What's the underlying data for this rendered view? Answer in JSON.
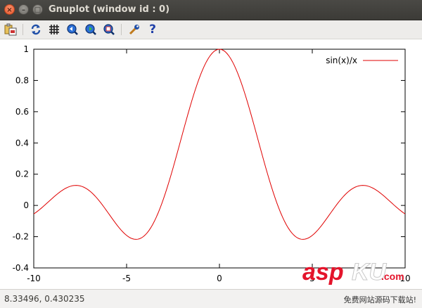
{
  "window": {
    "title": "Gnuplot (window id : 0)",
    "buttons": [
      "close",
      "minimize",
      "maximize"
    ]
  },
  "toolbar": {
    "icons": [
      "copy-to-clipboard-icon",
      "replot-icon",
      "grid-icon",
      "zoom-previous-icon",
      "zoom-next-icon",
      "zoom-autoscale-icon",
      "configuration-icon",
      "help-icon"
    ],
    "help_glyph": "?"
  },
  "chart_data": {
    "type": "line",
    "function": "sin(x)/x",
    "xlim": [
      -10,
      10
    ],
    "ylim": [
      -0.4,
      1
    ],
    "xticks": [
      -10,
      -5,
      0,
      5,
      10
    ],
    "yticks": [
      -0.4,
      -0.2,
      0,
      0.2,
      0.4,
      0.6,
      0.8,
      1
    ],
    "xtick_labels": [
      "-10",
      "-5",
      "0",
      "5",
      "10"
    ],
    "ytick_labels": [
      "-0.4",
      "-0.2",
      "0",
      "0.2",
      "0.4",
      "0.6",
      "0.8",
      "1"
    ],
    "grid": false,
    "legend_position": "top-right",
    "series": [
      {
        "name": "sin(x)/x",
        "color": "#e00000",
        "samples": 200
      }
    ]
  },
  "status": {
    "coords": "8.33496,  0.430235"
  },
  "watermark": {
    "brand_main": "asp",
    "brand_tail": "KU",
    "brand_suffix": ".com",
    "subtitle": "免费网站源码下载站!"
  }
}
